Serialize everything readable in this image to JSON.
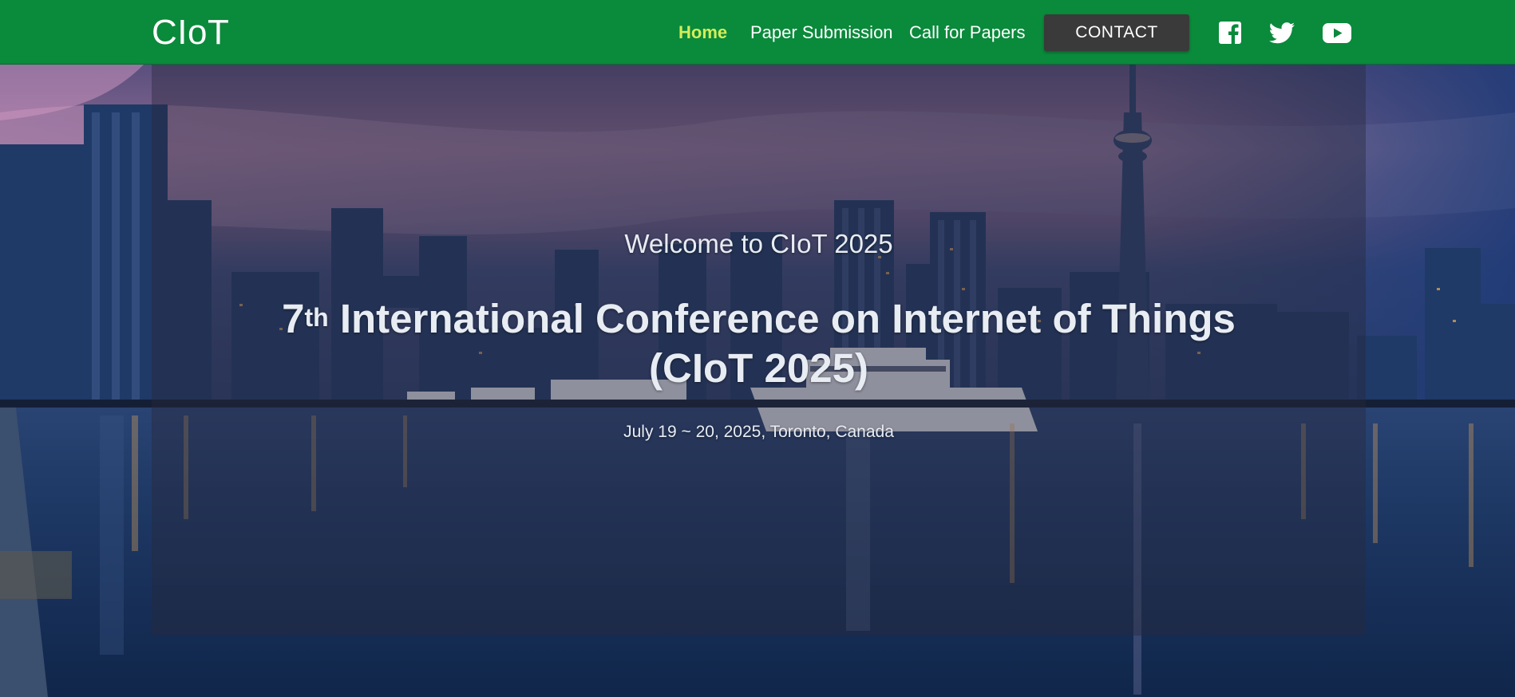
{
  "nav": {
    "brand": "CIoT",
    "links": {
      "home": "Home",
      "paper_submission": "Paper Submission",
      "call_for_papers": "Call for Papers"
    },
    "contact": "CONTACT",
    "social": [
      "facebook-icon",
      "twitter-icon",
      "youtube-icon"
    ],
    "active_color": "#d4ec5b",
    "bar_color": "#0a8a3b"
  },
  "hero": {
    "welcome": "Welcome to CIoT 2025",
    "title_number": "7",
    "title_suffix": "th",
    "title_rest": " International Conference on Internet of Things (CIoT 2025)",
    "date_location": "July 19 ~ 20, 2025, Toronto, Canada"
  }
}
